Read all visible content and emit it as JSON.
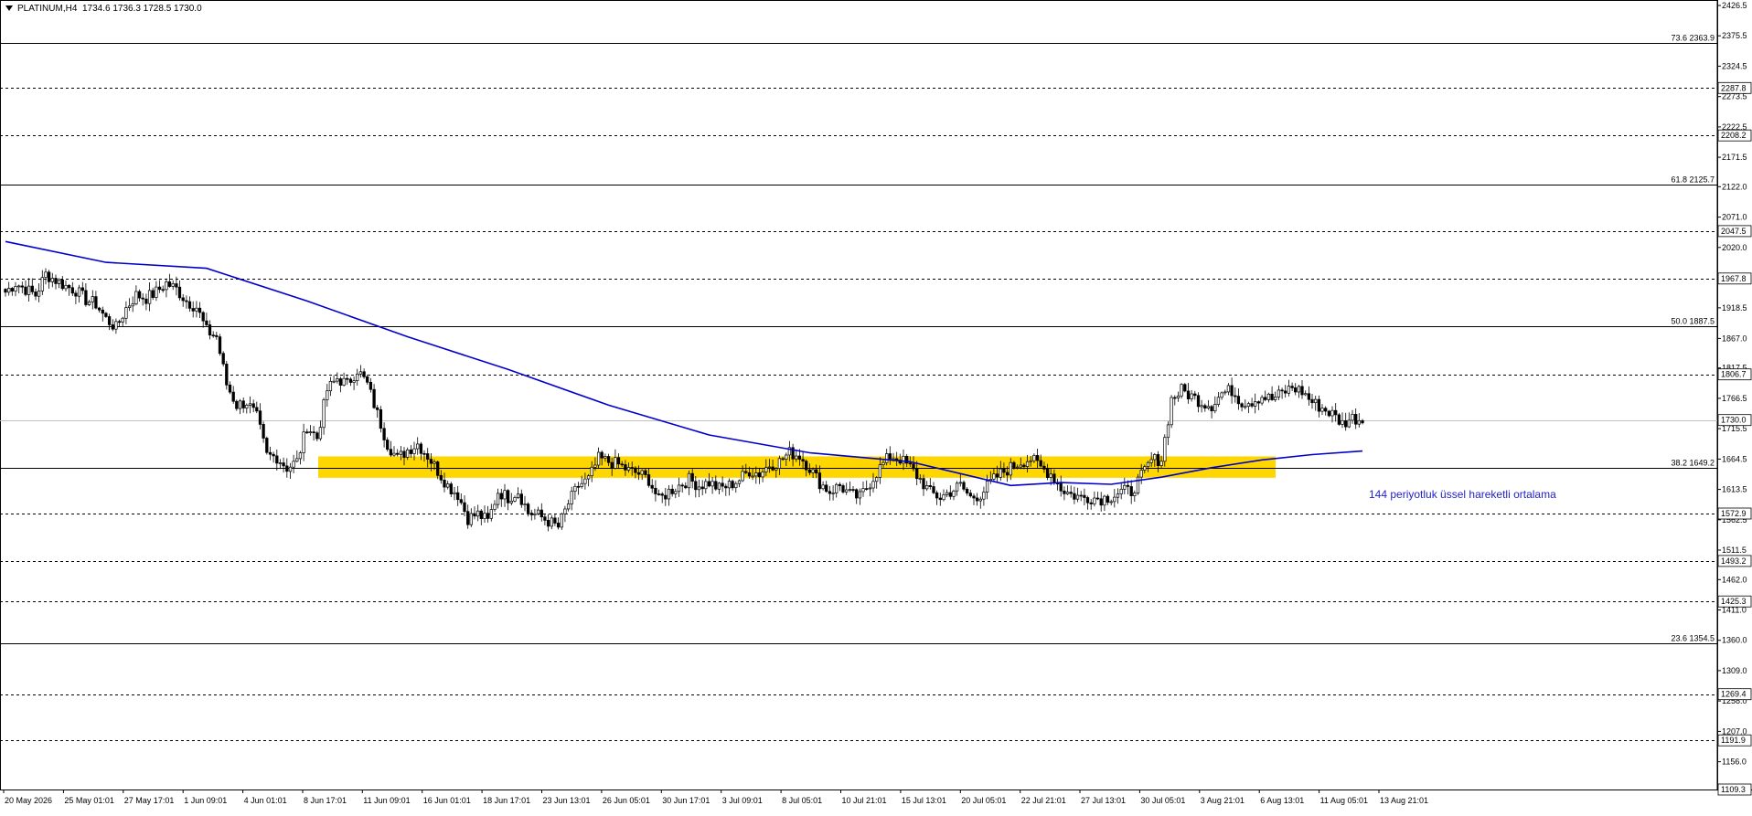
{
  "header": {
    "symbol_timeframe": "PLATINUM,H4",
    "ohlc": "1734.6 1736.3 1728.5 1730.0"
  },
  "colors": {
    "background": "#ffffff",
    "candle": "#000000",
    "ema_line": "#0000cc",
    "zone_fill": "#ffd700",
    "annotation_text": "#2222cc",
    "current_price_line": "#c0c0c0"
  },
  "chart_data": {
    "type": "candlestick",
    "title": "",
    "ylim": [
      1109.3,
      2426.5
    ],
    "price_axis_ticks": [
      "2426.5",
      "2375.5",
      "2324.5",
      "2273.5",
      "2222.5",
      "2171.5",
      "2122.0",
      "2071.0",
      "2020.0",
      "1918.5",
      "1867.0",
      "1817.5",
      "1766.5",
      "1715.5",
      "1664.5",
      "1613.5",
      "1562.5",
      "1511.5",
      "1462.0",
      "1411.0",
      "1360.0",
      "1309.0",
      "1258.0",
      "1207.0",
      "1156.0",
      "1109.3"
    ],
    "time_axis_labels": [
      "20 May 2026",
      "25 May 01:01",
      "27 May 17:01",
      "1 Jun 09:01",
      "4 Jun 01:01",
      "8 Jun 17:01",
      "11 Jun 09:01",
      "16 Jun 01:01",
      "18 Jun 17:01",
      "23 Jun 13:01",
      "26 Jun 05:01",
      "30 Jun 17:01",
      "3 Jul 09:01",
      "8 Jul 05:01",
      "10 Jul 21:01",
      "15 Jul 13:01",
      "20 Jul 05:01",
      "22 Jul 21:01",
      "27 Jul 13:01",
      "30 Jul 05:01",
      "3 Aug 21:01",
      "6 Aug 13:01",
      "11 Aug 05:01",
      "13 Aug 21:01"
    ],
    "horizontal_levels": [
      {
        "price": 2363.9,
        "label": "73.6 2363.9",
        "style": "solid",
        "kind": "fibonacci"
      },
      {
        "price": 2287.8,
        "label": "2287.8",
        "style": "dashed",
        "kind": "level"
      },
      {
        "price": 2208.2,
        "label": "2208.2",
        "style": "dashed",
        "kind": "level"
      },
      {
        "price": 2125.7,
        "label": "61.8 2125.7",
        "style": "solid",
        "kind": "fibonacci"
      },
      {
        "price": 2047.5,
        "label": "2047.5",
        "style": "dashed",
        "kind": "level"
      },
      {
        "price": 1967.8,
        "label": "1967.8",
        "style": "dashed",
        "kind": "level"
      },
      {
        "price": 1887.5,
        "label": "50.0 1887.5",
        "style": "solid",
        "kind": "fibonacci"
      },
      {
        "price": 1806.7,
        "label": "1806.7",
        "style": "dashed",
        "kind": "level"
      },
      {
        "price": 1649.2,
        "label": "38.2 1649.2",
        "style": "solid",
        "kind": "fibonacci"
      },
      {
        "price": 1572.9,
        "label": "1572.9",
        "style": "dashed",
        "kind": "level"
      },
      {
        "price": 1493.2,
        "label": "1493.2",
        "style": "dashed",
        "kind": "level"
      },
      {
        "price": 1425.3,
        "label": "1425.3",
        "style": "dashed",
        "kind": "level"
      },
      {
        "price": 1354.5,
        "label": "23.6 1354.5",
        "style": "solid",
        "kind": "fibonacci"
      },
      {
        "price": 1269.4,
        "label": "1269.4",
        "style": "dashed",
        "kind": "level"
      },
      {
        "price": 1191.9,
        "label": "1191.9",
        "style": "dashed",
        "kind": "level"
      },
      {
        "price": 1109.3,
        "label": "1109.3",
        "style": "dashed",
        "kind": "level"
      }
    ],
    "current_price": {
      "price": 1730.0,
      "label": "1730.0"
    },
    "support_zone": {
      "low": 1633,
      "high": 1669
    },
    "ema_annotation": "144 periyotluk üssel hareketli ortalama",
    "series": [
      {
        "type": "candlestick",
        "close_path": [
          [
            0,
            1945
          ],
          [
            6,
            1960
          ],
          [
            12,
            1950
          ],
          [
            18,
            1940
          ],
          [
            24,
            1975
          ],
          [
            30,
            1965
          ],
          [
            36,
            1955
          ],
          [
            42,
            1948
          ],
          [
            48,
            1932
          ],
          [
            54,
            1925
          ],
          [
            60,
            1900
          ],
          [
            66,
            1885
          ],
          [
            72,
            1918
          ],
          [
            78,
            1940
          ],
          [
            84,
            1935
          ],
          [
            90,
            1945
          ],
          [
            96,
            1960
          ],
          [
            102,
            1950
          ],
          [
            108,
            1930
          ],
          [
            114,
            1920
          ],
          [
            120,
            1880
          ],
          [
            126,
            1870
          ],
          [
            132,
            1790
          ],
          [
            138,
            1755
          ],
          [
            144,
            1760
          ],
          [
            150,
            1735
          ],
          [
            156,
            1670
          ],
          [
            162,
            1668
          ],
          [
            168,
            1650
          ],
          [
            174,
            1660
          ],
          [
            180,
            1720
          ],
          [
            186,
            1700
          ],
          [
            192,
            1780
          ],
          [
            198,
            1800
          ],
          [
            204,
            1790
          ],
          [
            210,
            1815
          ],
          [
            216,
            1790
          ],
          [
            222,
            1740
          ],
          [
            228,
            1690
          ],
          [
            234,
            1665
          ],
          [
            240,
            1680
          ],
          [
            246,
            1690
          ],
          [
            252,
            1670
          ],
          [
            258,
            1645
          ],
          [
            264,
            1620
          ],
          [
            270,
            1605
          ],
          [
            276,
            1565
          ],
          [
            282,
            1572
          ],
          [
            288,
            1560
          ],
          [
            294,
            1610
          ],
          [
            300,
            1600
          ],
          [
            306,
            1610
          ],
          [
            312,
            1575
          ],
          [
            318,
            1570
          ],
          [
            324,
            1560
          ],
          [
            330,
            1550
          ],
          [
            336,
            1590
          ],
          [
            342,
            1620
          ],
          [
            348,
            1630
          ],
          [
            354,
            1665
          ],
          [
            360,
            1660
          ],
          [
            366,
            1655
          ],
          [
            372,
            1645
          ],
          [
            378,
            1640
          ],
          [
            384,
            1630
          ],
          [
            390,
            1595
          ],
          [
            396,
            1610
          ],
          [
            402,
            1620
          ],
          [
            408,
            1630
          ],
          [
            414,
            1620
          ],
          [
            420,
            1625
          ],
          [
            426,
            1615
          ],
          [
            432,
            1620
          ],
          [
            438,
            1630
          ],
          [
            444,
            1645
          ],
          [
            450,
            1640
          ],
          [
            456,
            1655
          ],
          [
            462,
            1660
          ],
          [
            468,
            1675
          ],
          [
            474,
            1670
          ],
          [
            480,
            1650
          ],
          [
            486,
            1625
          ],
          [
            492,
            1610
          ],
          [
            498,
            1620
          ],
          [
            504,
            1605
          ],
          [
            510,
            1600
          ],
          [
            516,
            1625
          ],
          [
            522,
            1650
          ],
          [
            528,
            1670
          ],
          [
            534,
            1665
          ],
          [
            540,
            1650
          ],
          [
            546,
            1630
          ],
          [
            552,
            1608
          ],
          [
            558,
            1600
          ],
          [
            564,
            1610
          ],
          [
            570,
            1620
          ],
          [
            576,
            1600
          ],
          [
            582,
            1605
          ],
          [
            588,
            1625
          ],
          [
            594,
            1640
          ],
          [
            600,
            1650
          ],
          [
            606,
            1660
          ],
          [
            612,
            1665
          ],
          [
            618,
            1650
          ],
          [
            624,
            1640
          ],
          [
            630,
            1615
          ],
          [
            636,
            1605
          ],
          [
            642,
            1600
          ],
          [
            648,
            1600
          ],
          [
            654,
            1598
          ],
          [
            660,
            1602
          ],
          [
            666,
            1610
          ],
          [
            672,
            1610
          ],
          [
            678,
            1635
          ],
          [
            684,
            1662
          ],
          [
            690,
            1665
          ],
          [
            696,
            1765
          ],
          [
            702,
            1780
          ],
          [
            708,
            1770
          ],
          [
            714,
            1760
          ],
          [
            720,
            1755
          ],
          [
            726,
            1775
          ],
          [
            732,
            1780
          ],
          [
            738,
            1760
          ],
          [
            744,
            1762
          ],
          [
            750,
            1770
          ],
          [
            756,
            1765
          ],
          [
            762,
            1775
          ],
          [
            768,
            1785
          ],
          [
            774,
            1778
          ],
          [
            780,
            1760
          ],
          [
            786,
            1750
          ],
          [
            792,
            1740
          ],
          [
            798,
            1724
          ],
          [
            804,
            1734
          ],
          [
            810,
            1730
          ]
        ]
      },
      {
        "type": "line",
        "name": "144 periyotluk üssel hareketli ortalama",
        "path": [
          [
            0,
            2030
          ],
          [
            60,
            1995
          ],
          [
            120,
            1985
          ],
          [
            180,
            1930
          ],
          [
            240,
            1870
          ],
          [
            300,
            1815
          ],
          [
            360,
            1755
          ],
          [
            420,
            1705
          ],
          [
            480,
            1675
          ],
          [
            540,
            1660
          ],
          [
            570,
            1640
          ],
          [
            600,
            1620
          ],
          [
            630,
            1625
          ],
          [
            660,
            1622
          ],
          [
            690,
            1634
          ],
          [
            720,
            1650
          ],
          [
            750,
            1663
          ],
          [
            780,
            1672
          ],
          [
            810,
            1678
          ]
        ]
      }
    ]
  }
}
